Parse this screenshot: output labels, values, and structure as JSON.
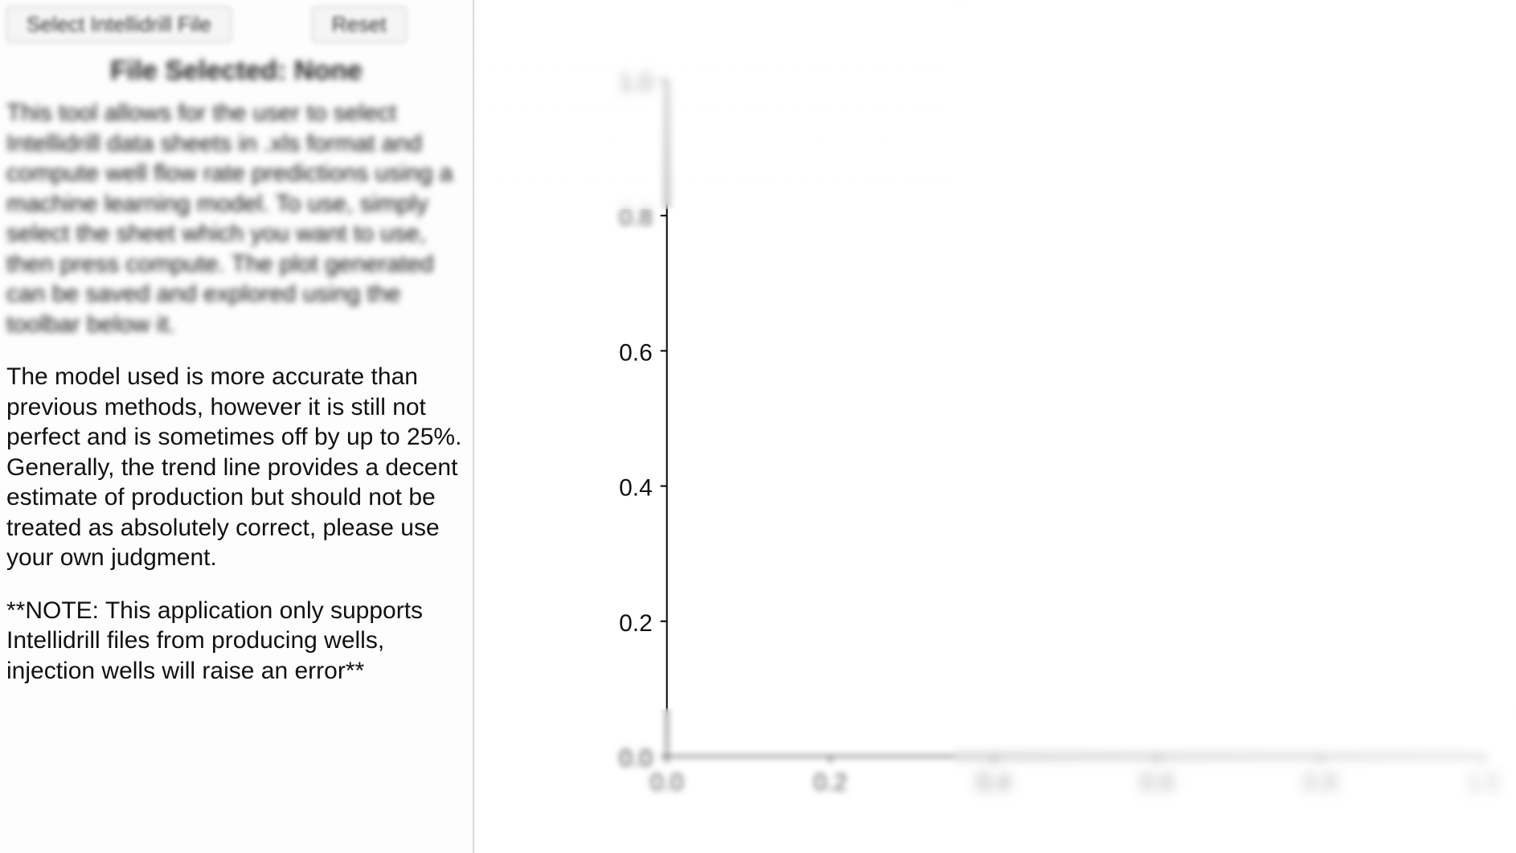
{
  "toolbar": {
    "select_button": "Select Intellidrill File",
    "reset_button": "Reset"
  },
  "file_status": "File Selected: None",
  "paragraphs": {
    "intro": "This tool allows for the user to select Intellidrill data sheets in .xls format and compute well flow rate predictions using a machine learning model. To use, simply select the sheet which you want to use, then press compute. The plot generated can be saved and explored using the toolbar below it.",
    "accuracy": "The model used is more accurate than previous methods, however it is still not perfect and is sometimes off by up to 25%. Generally, the trend line provides a decent estimate of production but should not be treated as absolutely correct, please use your own judgment.",
    "note": "**NOTE: This application only supports Intellidrill files from producing wells, injection wells will raise an error**"
  },
  "chart_data": {
    "type": "line",
    "title": "",
    "xlabel": "",
    "ylabel": "",
    "xlim": [
      0.0,
      1.0
    ],
    "ylim": [
      0.0,
      1.0
    ],
    "x_ticks": [
      0.0,
      0.2,
      0.4,
      0.6,
      0.8,
      1.0
    ],
    "y_ticks": [
      0.0,
      0.2,
      0.4,
      0.6,
      0.8,
      1.0
    ],
    "series": []
  },
  "axis": {
    "y": {
      "t0": "0.0",
      "t1": "0.2",
      "t2": "0.4",
      "t3": "0.6",
      "t4": "0.8",
      "t5": "1.0"
    },
    "x": {
      "t0": "0.0",
      "t1": "0.2",
      "t2": "0.4",
      "t3": "0.6",
      "t4": "0.8",
      "t5": "1.0"
    }
  }
}
